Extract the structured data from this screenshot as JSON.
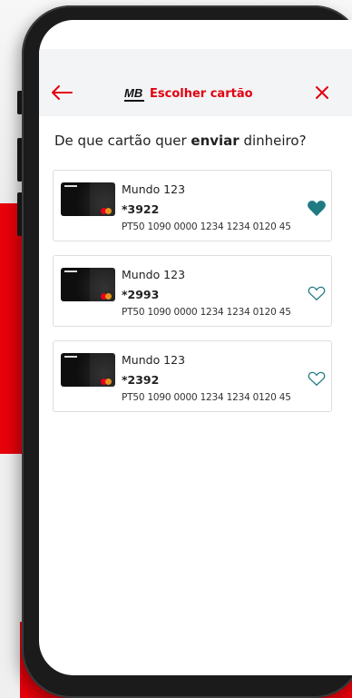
{
  "header": {
    "title": "Escolher cartão",
    "logo_text": "MB",
    "back_icon": "arrow-left-icon",
    "close_icon": "close-icon"
  },
  "question": {
    "prefix": "De que cartão quer ",
    "emphasis": "enviar",
    "suffix": " dinheiro?"
  },
  "cards": [
    {
      "name": "Mundo 123",
      "number": "*3922",
      "iban": "PT50 1090 0000 1234 1234 0120 45",
      "favorite": true
    },
    {
      "name": "Mundo 123",
      "number": "*2993",
      "iban": "PT50 1090 0000 1234 1234 0120 45",
      "favorite": false
    },
    {
      "name": "Mundo 123",
      "number": "*2392",
      "iban": "PT50 1090 0000 1234 1234 0120 45",
      "favorite": false
    }
  ],
  "colors": {
    "accent": "#e3000f",
    "favorite": "#1f7a82",
    "background_red": "#e8000b"
  }
}
